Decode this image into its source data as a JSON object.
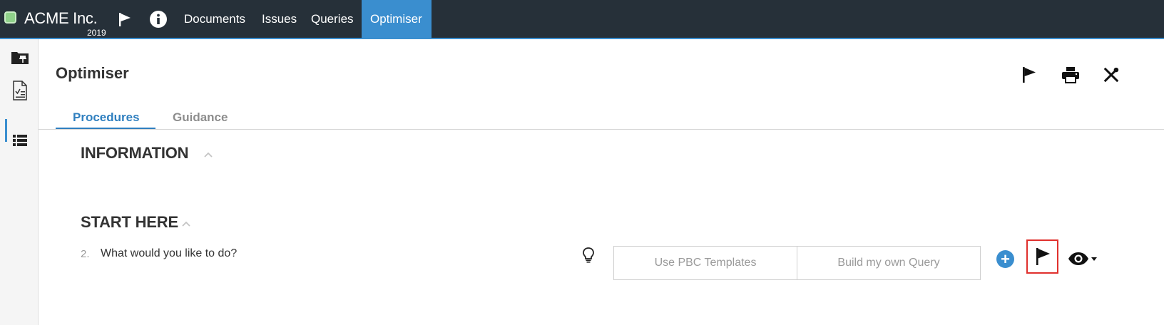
{
  "brand": {
    "name": "ACME Inc.",
    "year": "2019"
  },
  "topnav": {
    "items": [
      {
        "label": "Documents"
      },
      {
        "label": "Issues"
      },
      {
        "label": "Queries"
      },
      {
        "label": "Optimiser",
        "active": true
      }
    ],
    "icons": [
      "flag-icon",
      "info-icon"
    ]
  },
  "sidebar": {
    "icons": [
      "pinned-folder-icon",
      "checklist-document-icon",
      "list-view-icon"
    ]
  },
  "page": {
    "title": "Optimiser"
  },
  "toolbar": {
    "icons": [
      "flag-icon",
      "print-icon",
      "tools-icon"
    ]
  },
  "tabs": [
    {
      "label": "Procedures",
      "active": true
    },
    {
      "label": "Guidance"
    }
  ],
  "sections": [
    {
      "heading": "INFORMATION"
    },
    {
      "heading": "START HERE"
    }
  ],
  "question": {
    "number": "2.",
    "text": "What would you like to do?",
    "options": [
      "Use PBC Templates",
      "Build my own Query"
    ],
    "add_label": "+"
  },
  "colors": {
    "topbar": "#263039",
    "accent": "#3a8ecf",
    "highlight_border": "#e0302d"
  }
}
